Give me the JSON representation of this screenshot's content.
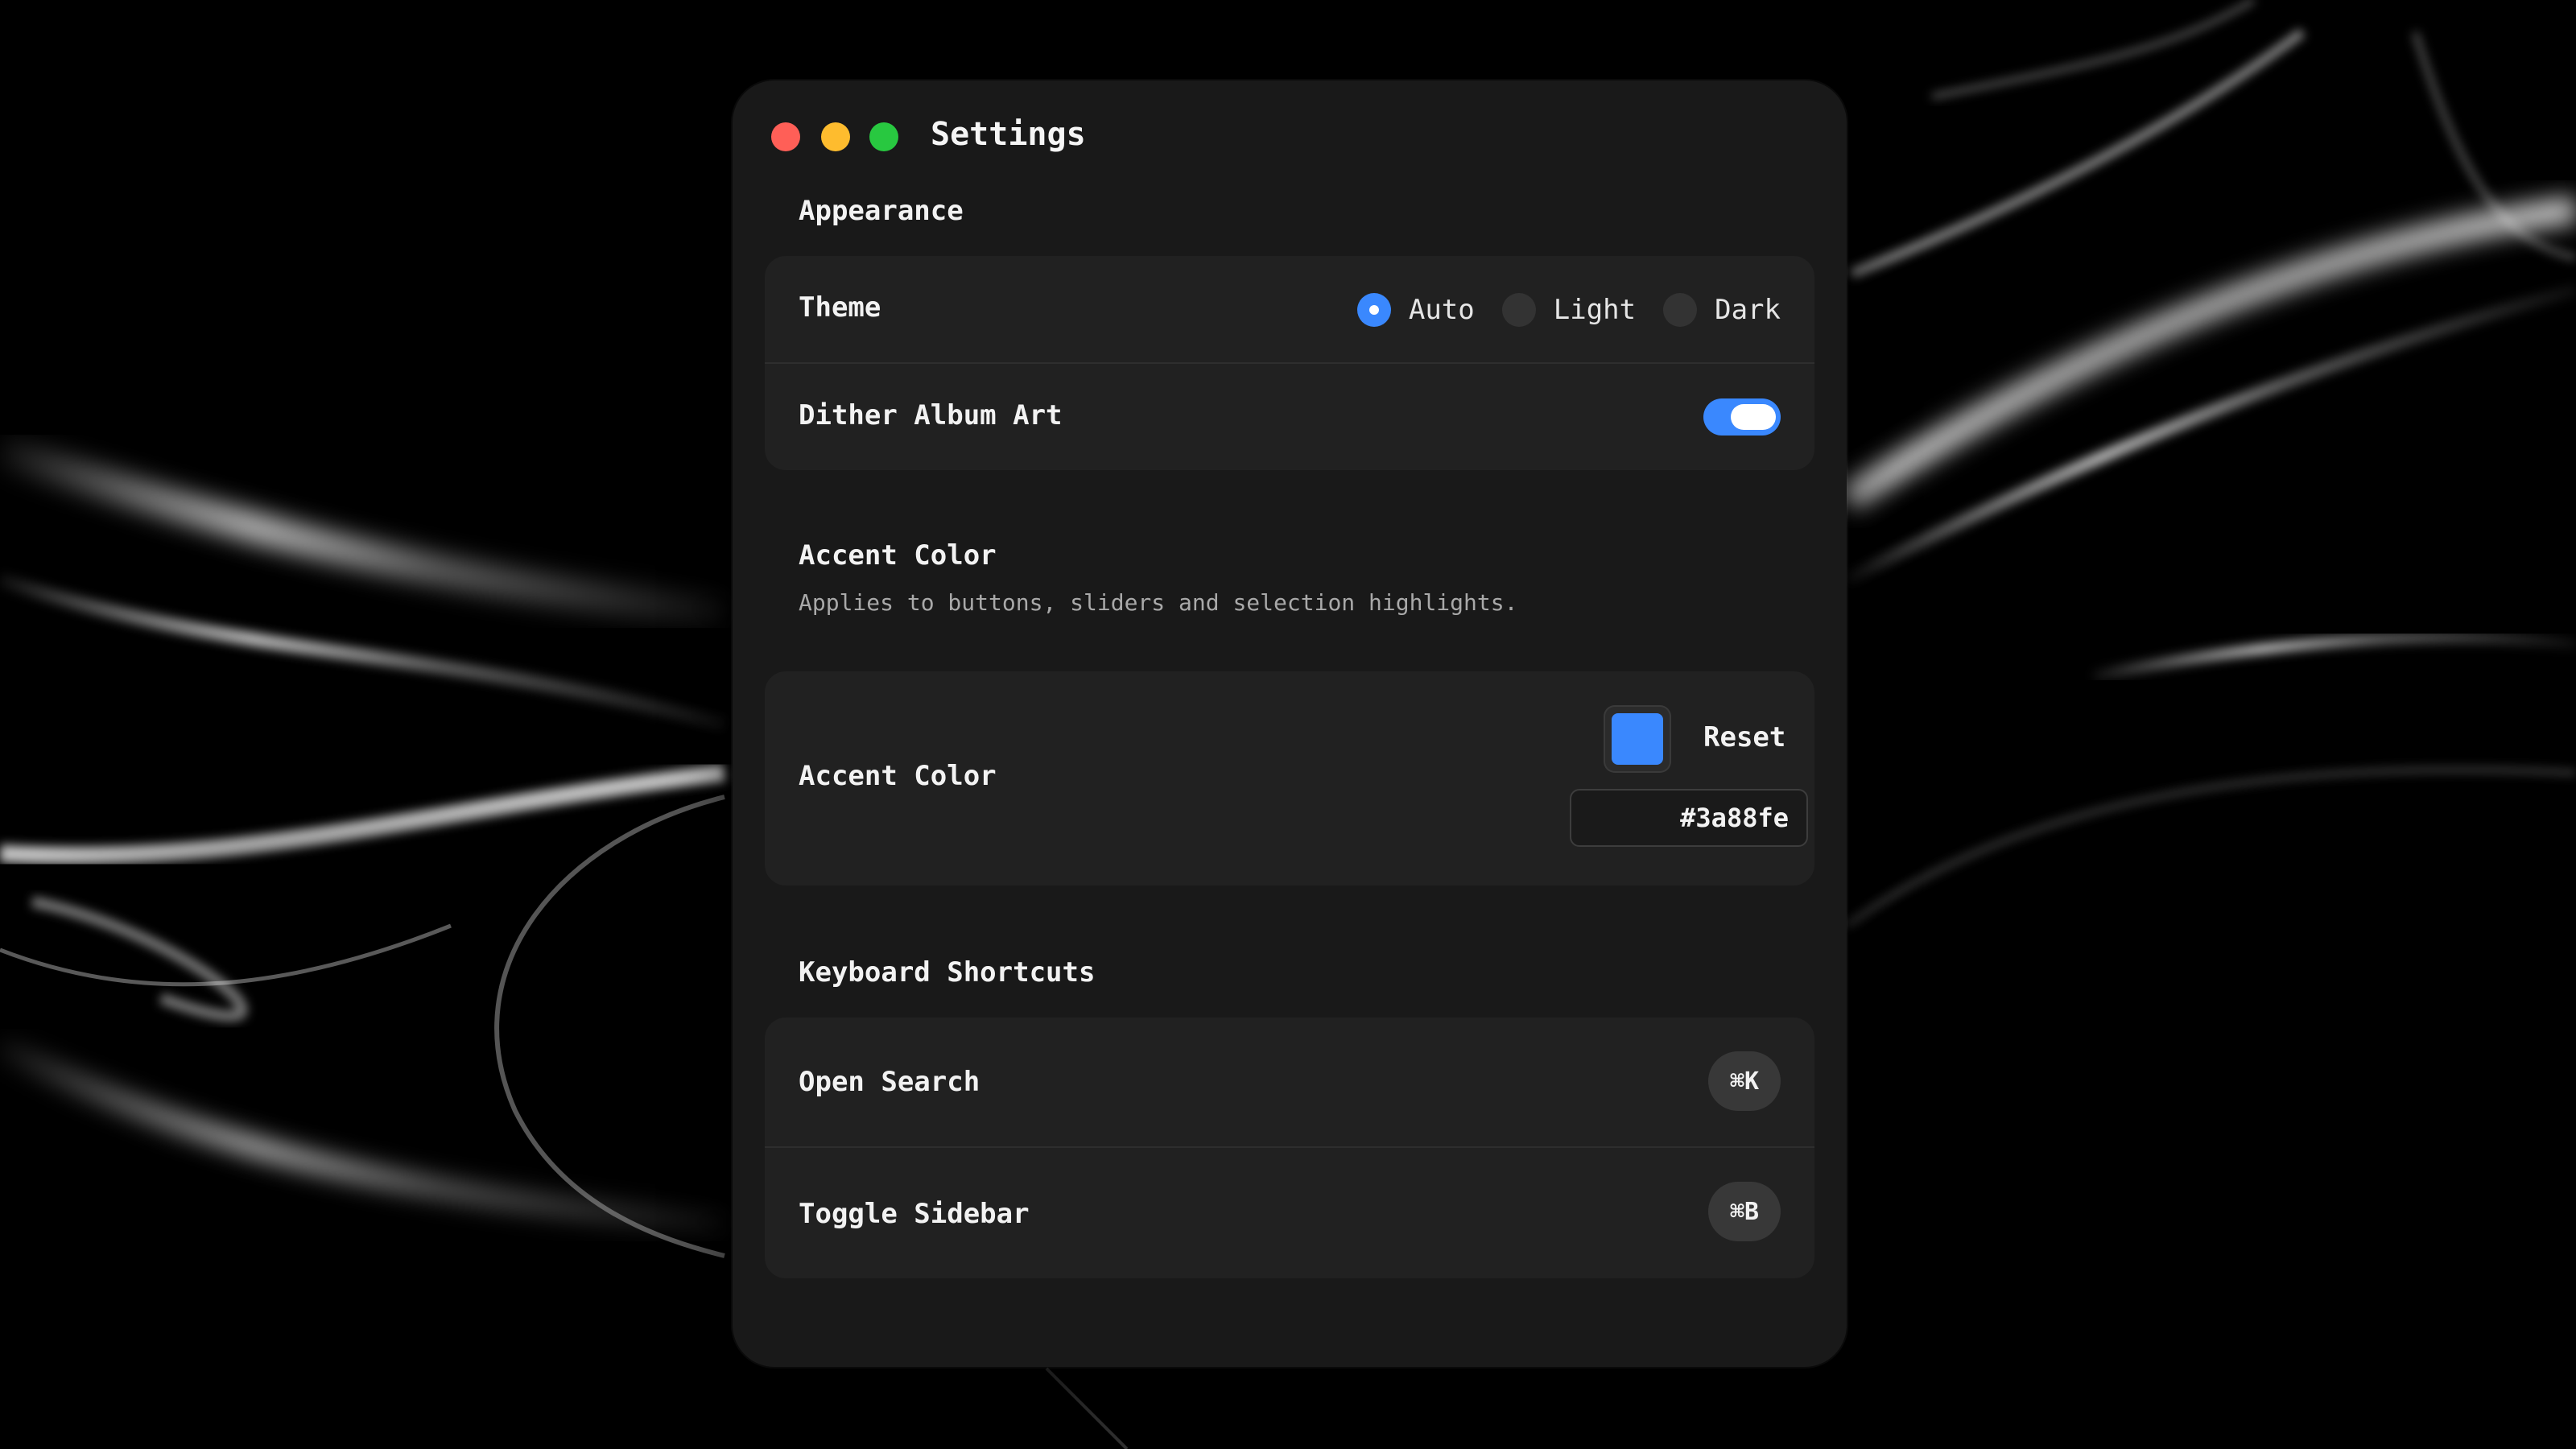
{
  "window": {
    "title": "Settings"
  },
  "appearance": {
    "heading": "Appearance",
    "theme": {
      "label": "Theme",
      "options": [
        {
          "label": "Auto",
          "checked": true
        },
        {
          "label": "Light",
          "checked": false
        },
        {
          "label": "Dark",
          "checked": false
        }
      ]
    },
    "dither": {
      "label": "Dither Album Art",
      "enabled": true
    }
  },
  "accent": {
    "heading": "Accent Color",
    "description": "Applies to buttons, sliders and selection highlights.",
    "row_label": "Accent Color",
    "reset_label": "Reset",
    "hex_value": "#3a88fe",
    "color": "#3a88fe"
  },
  "shortcuts": {
    "heading": "Keyboard Shortcuts",
    "items": [
      {
        "label": "Open Search",
        "keys": "⌘K"
      },
      {
        "label": "Toggle Sidebar",
        "keys": "⌘B"
      }
    ]
  },
  "colors": {
    "close": "#ff5f57",
    "minimize": "#febc2e",
    "maximize": "#28c840",
    "accent": "#3a88fe",
    "window_bg": "#191919",
    "card_bg": "#212121"
  }
}
